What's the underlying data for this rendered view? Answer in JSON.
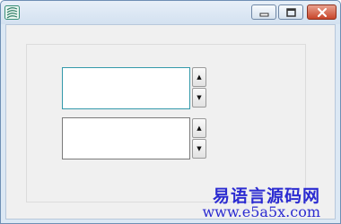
{
  "window": {
    "title": ""
  },
  "titlebar": {
    "app_icon": "app-icon",
    "buttons": [
      "minimize-icon",
      "maximize-icon",
      "close-icon"
    ]
  },
  "controls": {
    "spin_up_glyph": "▲",
    "spin_down_glyph": "▼"
  },
  "watermark": {
    "line1": "易语言源码网",
    "line2": "www.e5a5x.com"
  },
  "colors": {
    "titlebar": "#d3e1f0",
    "client": "#f0f0f0",
    "close": "#c8462a",
    "watermark": "#2b2bd1",
    "focus_border": "#3399aa"
  }
}
